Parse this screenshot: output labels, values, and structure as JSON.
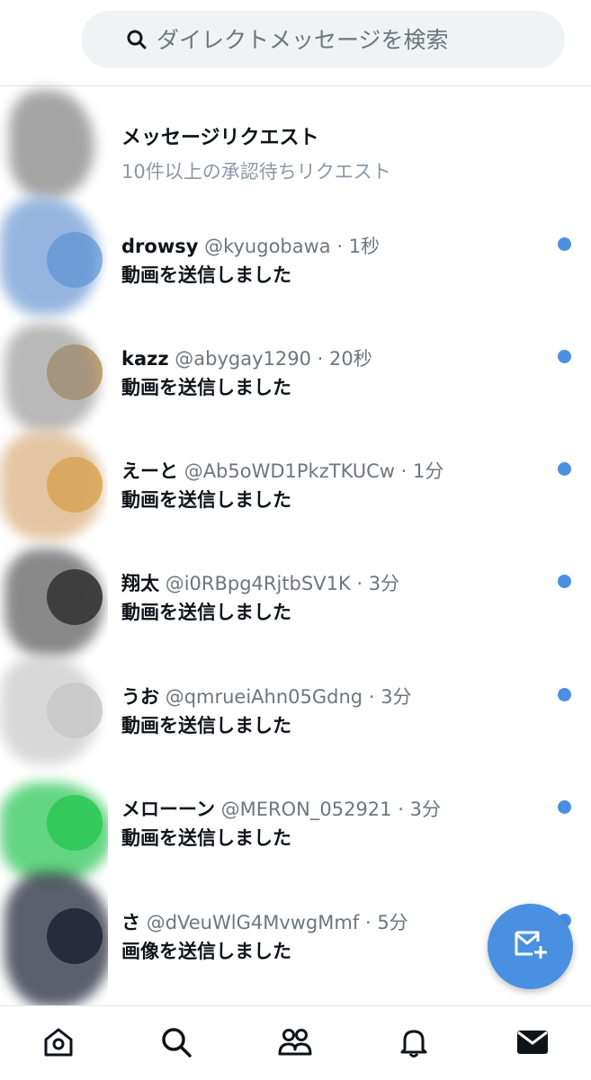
{
  "search": {
    "placeholder": "ダイレクトメッセージを検索"
  },
  "message_requests": {
    "title": "メッセージリクエスト",
    "subtitle": "10件以上の承認待ちリクエスト"
  },
  "conversations": [
    {
      "name": "drowsy",
      "handle": "@kyugobawa",
      "separator": "·",
      "time": "1秒",
      "message": "動画を送信しました",
      "unread": true,
      "avatar_color": "#8fb6e0"
    },
    {
      "name": "kazz",
      "handle": "@abygay1290",
      "separator": "·",
      "time": "20秒",
      "message": "動画を送信しました",
      "unread": true,
      "avatar_color": "#c9a56b"
    },
    {
      "name": "えーと",
      "handle": "@Ab5oWD1PkzTKUCw",
      "separator": "·",
      "time": "1分",
      "message": "動画を送信しました",
      "unread": true,
      "avatar_color": "#e6b760"
    },
    {
      "name": "翔太",
      "handle": "@i0RBpg4RjtbSV1K",
      "separator": "·",
      "time": "3分",
      "message": "動画を送信しました",
      "unread": true,
      "avatar_color": "#444444"
    },
    {
      "name": "うお",
      "handle": "@qmrueiAhn05Gdng",
      "separator": "·",
      "time": "3分",
      "message": "動画を送信しました",
      "unread": true,
      "avatar_color": "#cfcfcf"
    },
    {
      "name": "メローーン",
      "handle": "@MERON_052921",
      "separator": "·",
      "time": "3分",
      "message": "動画を送信しました",
      "unread": true,
      "avatar_color": "#3fcf63"
    },
    {
      "name": "さ",
      "handle": "@dVeuWlG4MvwgMmf",
      "separator": "·",
      "time": "5分",
      "message": "画像を送信しました",
      "unread": true,
      "avatar_color": "#2b3040"
    }
  ],
  "fab": {
    "icon": "new-message-icon",
    "color": "#4a90e2"
  },
  "tabbar": {
    "items": [
      {
        "icon": "home-icon",
        "active": false
      },
      {
        "icon": "search-icon",
        "active": false
      },
      {
        "icon": "communities-icon",
        "active": false
      },
      {
        "icon": "notifications-icon",
        "active": false
      },
      {
        "icon": "messages-icon",
        "active": true
      }
    ]
  },
  "colors": {
    "accent": "#4a90e2",
    "text": "#0f1419",
    "secondary": "#6e767d"
  }
}
